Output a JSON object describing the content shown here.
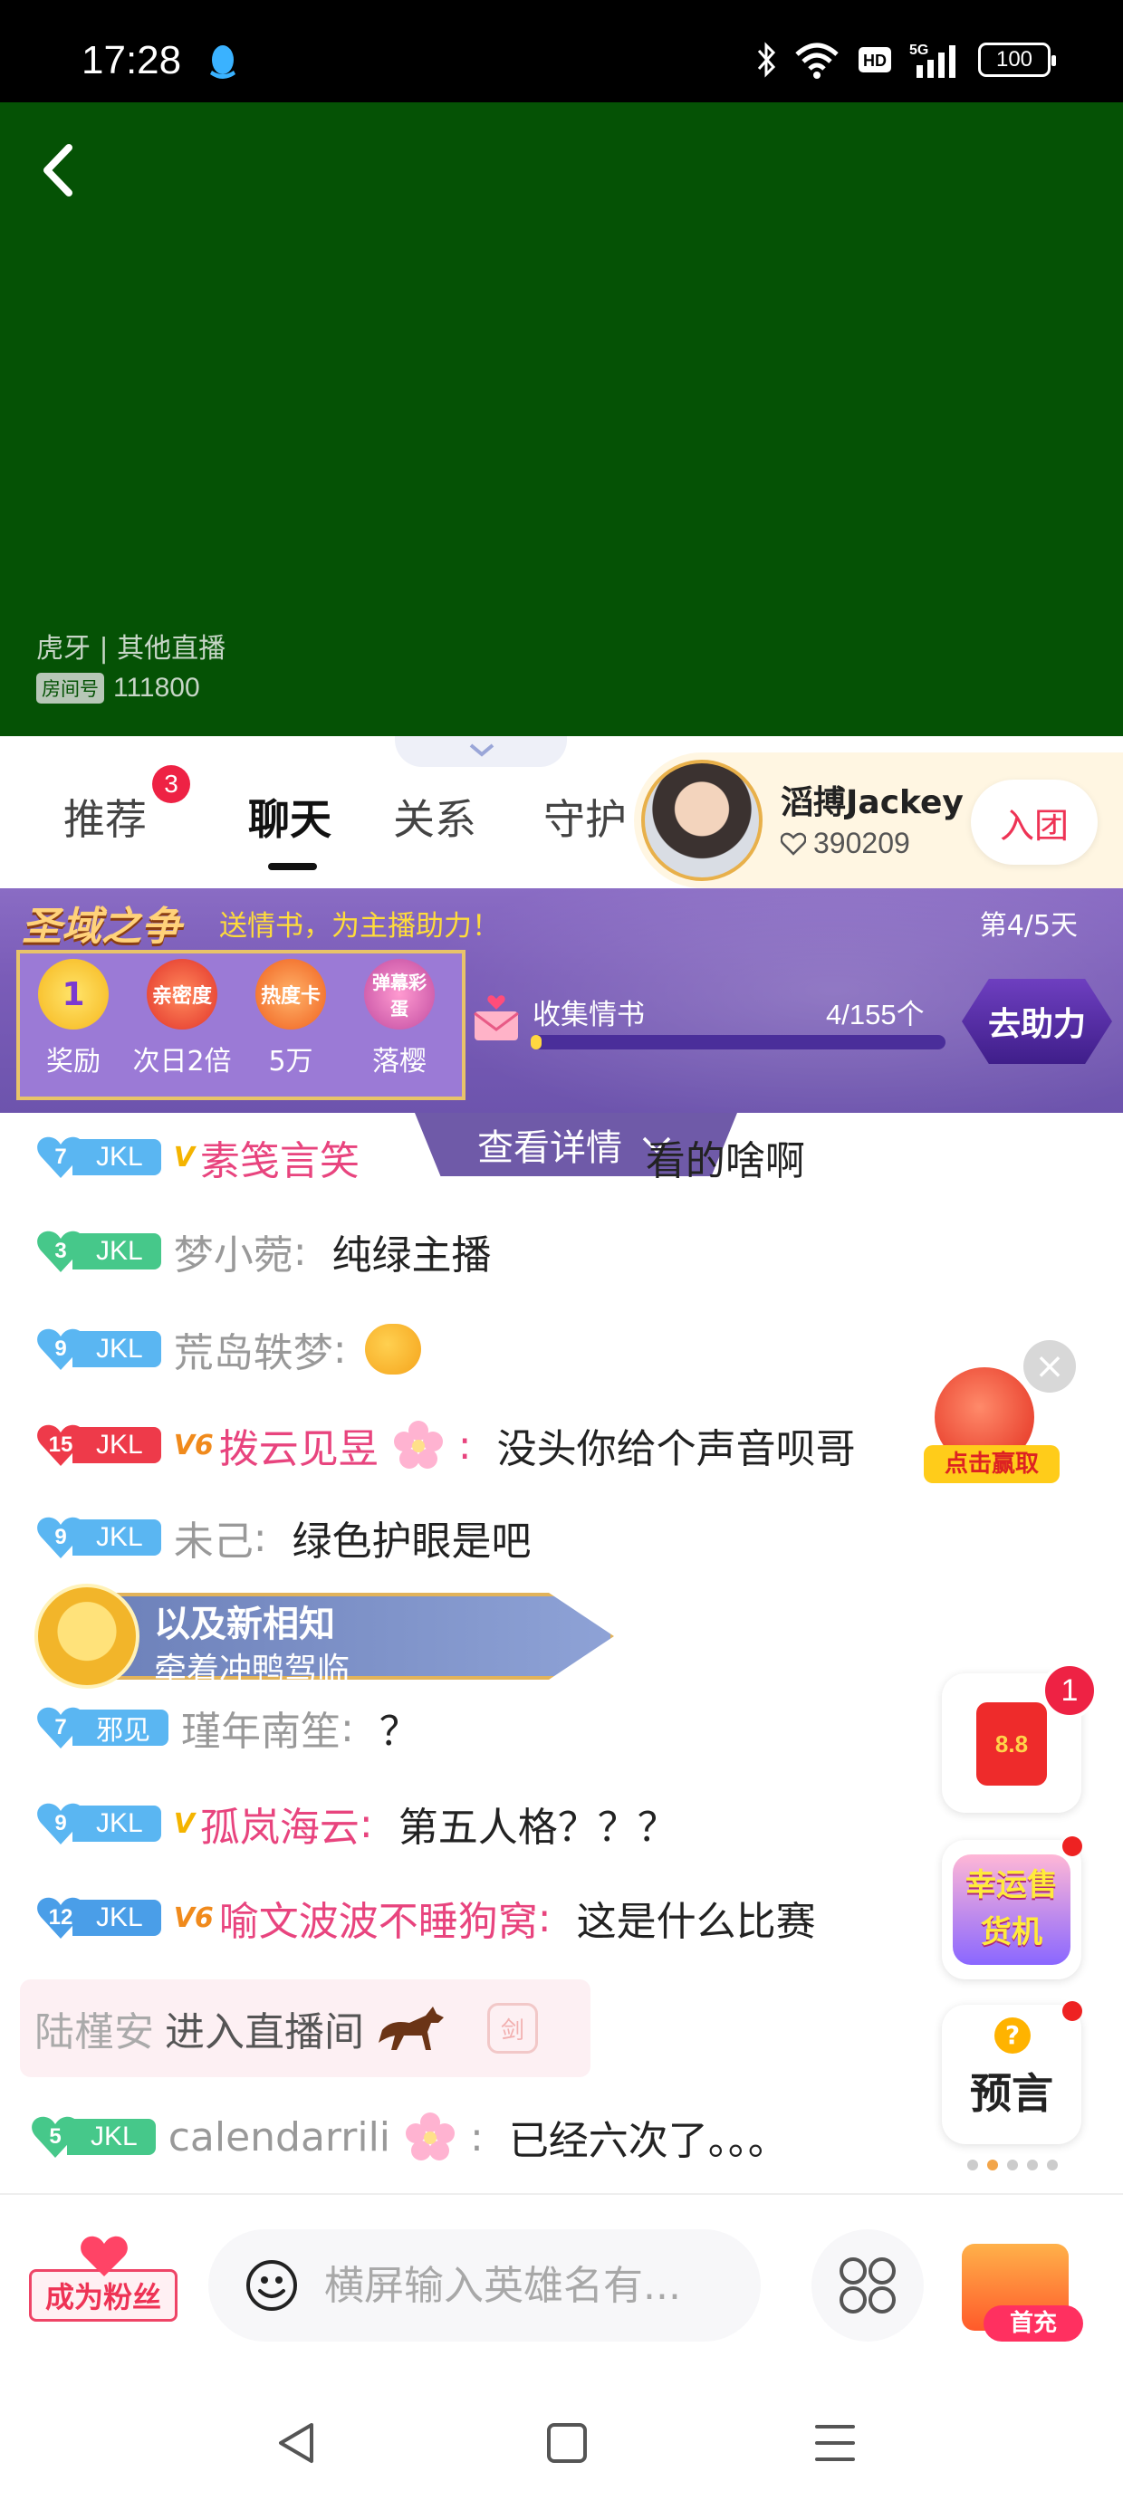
{
  "status_bar": {
    "time": "17:28",
    "battery": "100",
    "icons": [
      "qq-icon",
      "bluetooth-icon",
      "wifi-icon",
      "hd-icon",
      "5g-signal-icon",
      "battery-icon"
    ]
  },
  "video": {
    "source": "虎牙 | 其他直播",
    "room_tag": "房间号",
    "room_number": "111800",
    "background_color": "#055205"
  },
  "tabs": [
    {
      "label": "推荐",
      "badge": "3"
    },
    {
      "label": "聊天",
      "active": true
    },
    {
      "label": "关系"
    },
    {
      "label": "守护"
    }
  ],
  "anchor": {
    "name": "滔搏Jackey",
    "fans": "390209",
    "join_label": "入团"
  },
  "event": {
    "title": "圣域之争",
    "slogan": "送情书，为主播助力！",
    "day": "第4/5天",
    "rewards": [
      {
        "icon_text": "1",
        "label": "奖励"
      },
      {
        "icon_text": "亲密度",
        "label": "次日2倍"
      },
      {
        "icon_text": "热度卡",
        "label": "5万"
      },
      {
        "icon_text": "弹幕彩蛋",
        "label": "落樱"
      }
    ],
    "collect_label": "收集情书",
    "collect_count": "4/155个",
    "collect_progress": 0.026,
    "help_button": "去助力",
    "details_label": "查看详情"
  },
  "chat": [
    {
      "level": "7",
      "tag": "JKL",
      "vip": "V",
      "user": "素笺言笑",
      "text": "看的啥啊",
      "style": "pink"
    },
    {
      "level": "3",
      "tag": "JKL",
      "user": "梦小菀",
      "text": "纯绿主播",
      "style": "gray"
    },
    {
      "level": "9",
      "tag": "JKL",
      "user": "荒岛轶梦",
      "text": "",
      "style": "gray"
    },
    {
      "level": "15",
      "tag": "JKL",
      "vip": "V6",
      "user": "拨云见昱",
      "text": "没头你给个声音呗哥",
      "style": "pink"
    },
    {
      "level": "9",
      "tag": "JKL",
      "user": "未己",
      "text": "绿色护眼是吧",
      "style": "gray"
    },
    {
      "level": "7",
      "tag": "邪见",
      "user": "瑾年南笙",
      "text": "？",
      "style": "gray"
    },
    {
      "level": "9",
      "tag": "JKL",
      "vip": "V",
      "user": "孤岚海云",
      "text": "第五人格？？？",
      "style": "pink"
    },
    {
      "level": "12",
      "tag": "JKL",
      "vip": "V6",
      "user": "喻文波波不睡狗窝",
      "text": "这是什么比赛",
      "style": "pink"
    },
    {
      "level": "5",
      "tag": "JKL",
      "user": "calendarrili",
      "text": "已经六次了。。。",
      "style": "gray"
    }
  ],
  "member_banner": {
    "name": "以及新相知",
    "subtitle": "牵着冲鸭驾临"
  },
  "enter_notice": {
    "user": "陆槿安",
    "text": "进入直播间",
    "badge": "剑"
  },
  "widgets": {
    "rocket_label": "点击赢取",
    "redpacket_text": "8.8",
    "redpacket_badge": "1",
    "vending_label": "幸运售货机",
    "prophecy_label": "预言",
    "prophecy_q": "?"
  },
  "bottom_bar": {
    "fan_label": "成为粉丝",
    "input_placeholder": "横屏输入英雄名有...",
    "recharge_label": "首充"
  }
}
